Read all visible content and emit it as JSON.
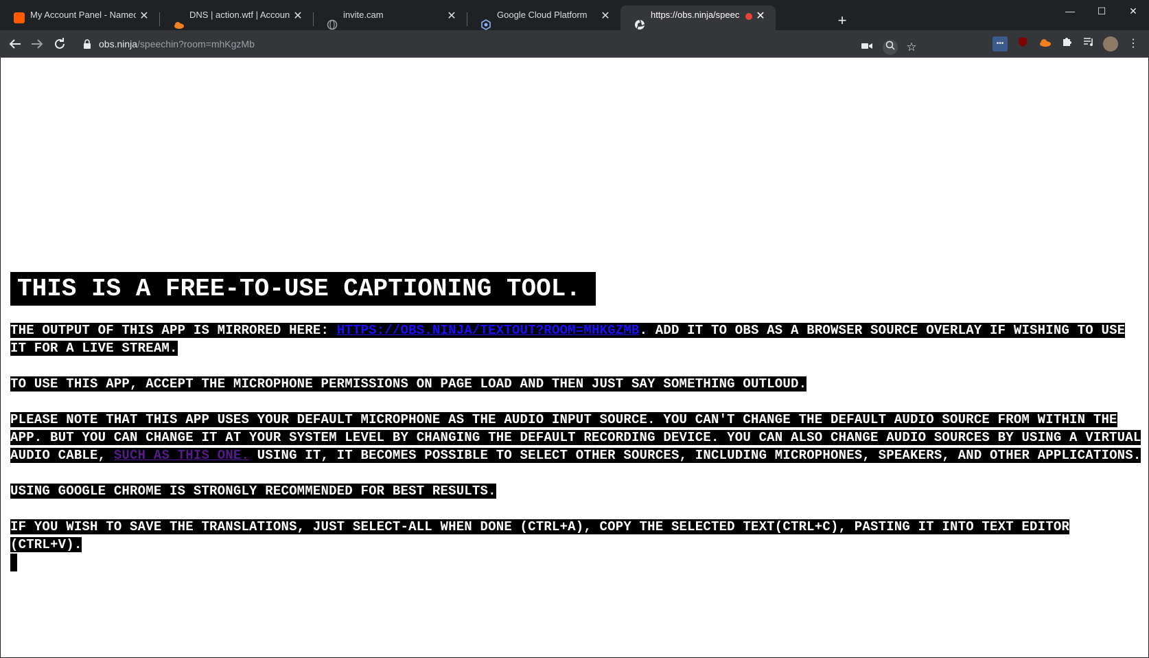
{
  "browser": {
    "tabs": [
      {
        "title": "My Account Panel - Namecheap.com",
        "favicon_color": "#ff5a00",
        "active": false
      },
      {
        "title": "DNS | action.wtf | Account | Cloudflare",
        "favicon_color": "#f38020",
        "active": false
      },
      {
        "title": "invite.cam",
        "favicon_color": "#9aa0a6",
        "active": false
      },
      {
        "title": "Google Cloud Platform",
        "favicon_color": "#4285f4",
        "active": false
      },
      {
        "title": "https://obs.ninja/speechin?room=mhKgzMb",
        "favicon_color": "#e8eaed",
        "active": true
      }
    ],
    "recording_dot_color": "#ea4335",
    "new_tab_label": "+",
    "url_host": "obs.ninja",
    "url_path": "/speechin?room=mhKgzMb",
    "window_controls": {
      "minimize": "—",
      "maximize": "☐",
      "close": "✕"
    }
  },
  "page": {
    "heading": "THIS IS A FREE-TO-USE CAPTIONING TOOL.",
    "p1_before": "THE OUTPUT OF THIS APP IS MIRRORED HERE: ",
    "p1_link": "HTTPS://OBS.NINJA/TEXTOUT?ROOM=MHKGZMB",
    "p1_after": ". ADD IT TO OBS AS A BROWSER SOURCE OVERLAY IF WISHING TO USE IT FOR A LIVE STREAM.",
    "p2": "TO USE THIS APP, ACCEPT THE MICROPHONE PERMISSIONS ON PAGE LOAD AND THEN JUST SAY SOMETHING OUTLOUD.",
    "p3_before": "PLEASE NOTE THAT THIS APP USES YOUR DEFAULT MICROPHONE AS THE AUDIO INPUT SOURCE. YOU CAN'T CHANGE THE DEFAULT AUDIO SOURCE FROM WITHIN THE APP. BUT YOU CAN CHANGE IT AT YOUR SYSTEM LEVEL BY CHANGING THE DEFAULT RECORDING DEVICE. YOU CAN ALSO CHANGE AUDIO SOURCES BY USING A VIRTUAL AUDIO CABLE, ",
    "p3_link": "SUCH AS THIS ONE.",
    "p3_after": " USING IT, IT BECOMES POSSIBLE TO SELECT OTHER SOURCES, INCLUDING MICROPHONES, SPEAKERS, AND OTHER APPLICATIONS.",
    "p4": "USING GOOGLE CHROME IS STRONGLY RECOMMENDED FOR BEST RESULTS.",
    "p5": "IF YOU WISH TO SAVE THE TRANSLATIONS, JUST SELECT-ALL WHEN DONE (CTRL+A), COPY THE SELECTED TEXT(CTRL+C), PASTING IT INTO TEXT EDITOR (CTRL+V)."
  }
}
